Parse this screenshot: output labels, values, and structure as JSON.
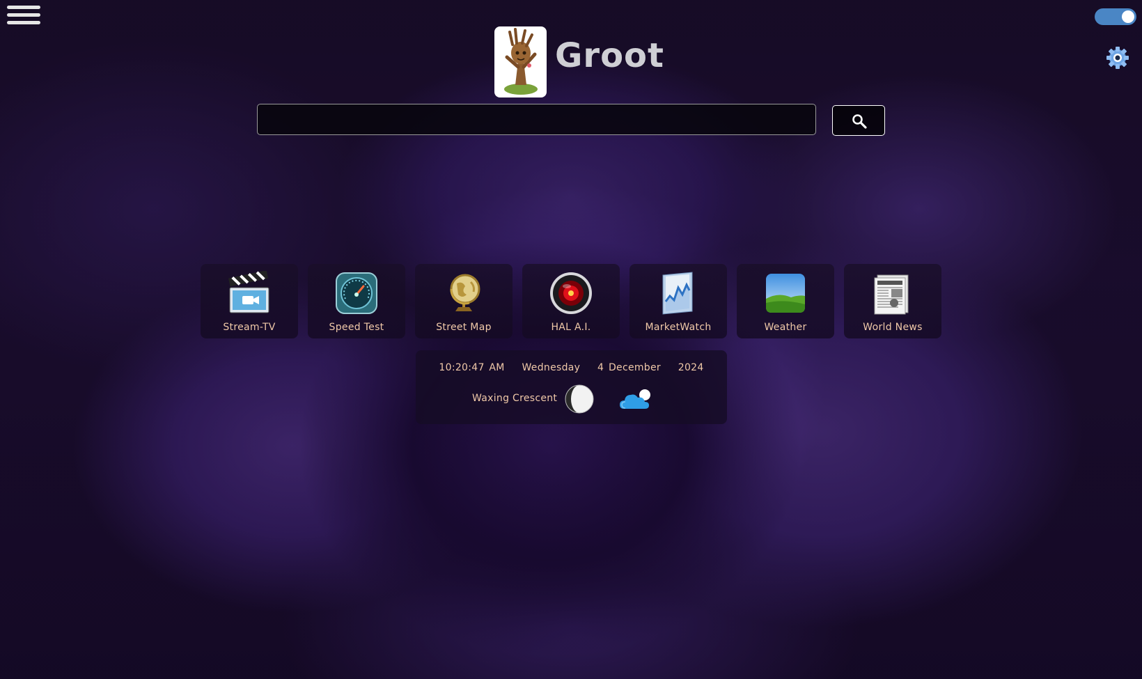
{
  "brand": {
    "name": "Groot"
  },
  "search": {
    "value": "",
    "placeholder": ""
  },
  "apps": [
    {
      "label": "Stream-TV",
      "icon": "clapperboard-icon"
    },
    {
      "label": "Speed Test",
      "icon": "speedometer-icon"
    },
    {
      "label": "Street Map",
      "icon": "globe-icon"
    },
    {
      "label": "HAL A.I.",
      "icon": "hal-eye-icon"
    },
    {
      "label": "MarketWatch",
      "icon": "stock-chart-icon"
    },
    {
      "label": "Weather",
      "icon": "landscape-icon"
    },
    {
      "label": "World News",
      "icon": "newspaper-icon"
    }
  ],
  "info": {
    "time": "10:20:47 AM",
    "weekday": "Wednesday",
    "date": "4 December",
    "year": "2024",
    "moon_phase": "Waxing Crescent"
  },
  "toggle": {
    "on": true
  },
  "colors": {
    "accent_text": "#f0c9a8",
    "toggle": "#4a86c5",
    "brand_text": "#cfcfd4"
  }
}
